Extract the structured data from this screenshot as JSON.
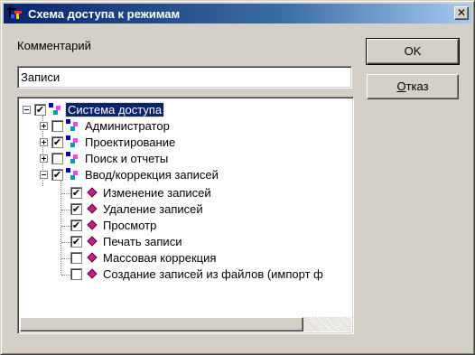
{
  "window": {
    "title": "Схема доступа к режимам",
    "close_glyph": "✕"
  },
  "comment": {
    "label": "Комментарий",
    "value": "Записи"
  },
  "buttons": {
    "ok": "OK",
    "cancel_underlined": "О",
    "cancel_rest": "тказ"
  },
  "tree": {
    "root": {
      "label": "Система доступа",
      "checked": "✔",
      "expanded": true,
      "selected": true
    },
    "groups": [
      {
        "label": "Администратор",
        "checked": "",
        "expanded": false
      },
      {
        "label": "Проектирование",
        "checked": "✔",
        "expanded": false
      },
      {
        "label": "Поиск и отчеты",
        "checked": "",
        "expanded": false
      },
      {
        "label": "Ввод/коррекция записей",
        "checked": "✔",
        "expanded": true
      }
    ],
    "leaves": [
      {
        "label": "Изменение записей",
        "checked": "✔"
      },
      {
        "label": "Удаление записей",
        "checked": "✔"
      },
      {
        "label": "Просмотр",
        "checked": "✔"
      },
      {
        "label": "Печать записи",
        "checked": "✔"
      },
      {
        "label": "Массовая коррекция",
        "checked": ""
      },
      {
        "label": "Создание записей из файлов (импорт ф",
        "checked": ""
      }
    ]
  },
  "colors": {
    "face": "#d4d0c8",
    "title_start": "#0a246a",
    "selection": "#0a246a",
    "leaf_icon": "#c0208a"
  }
}
